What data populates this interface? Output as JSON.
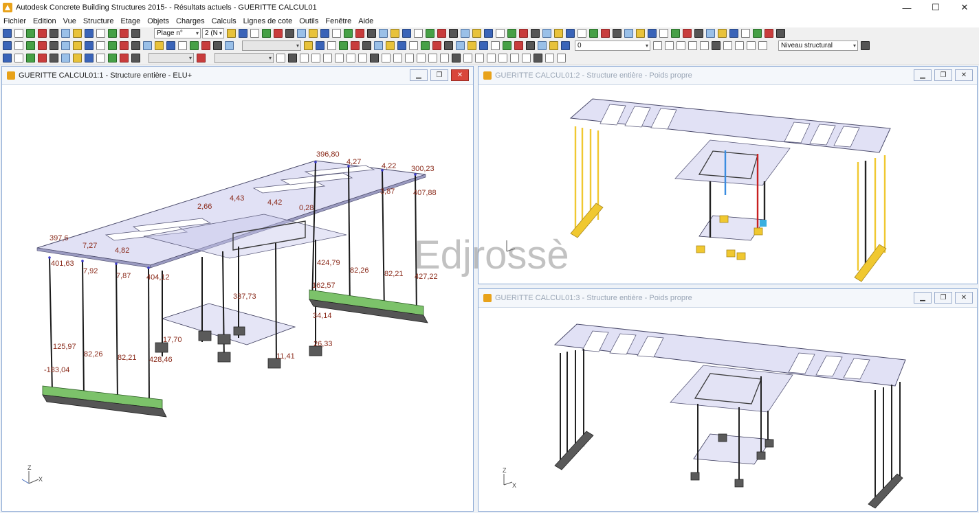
{
  "app": {
    "title": "Autodesk Concrete Building Structures 2015- - Résultats actuels - GUERITTE CALCUL01",
    "min_glyph": "—",
    "max_glyph": "☐",
    "close_glyph": "✕"
  },
  "menu": {
    "items": [
      "Fichier",
      "Edition",
      "Vue",
      "Structure",
      "Etage",
      "Objets",
      "Charges",
      "Calculs",
      "Lignes de cote",
      "Outils",
      "Fenêtre",
      "Aide"
    ]
  },
  "toolbars": {
    "level_combo": "Plage n°",
    "level_combo2": "2 (N",
    "layer_combo": "0",
    "niveau_combo": "Niveau structural"
  },
  "windows": [
    {
      "title": "GUERITTE CALCUL01:1 - Structure entière - ELU+",
      "active": true
    },
    {
      "title": "GUERITTE CALCUL01:2 - Structure entière - Poids propre",
      "active": false
    },
    {
      "title": "GUERITTE CALCUL01:3 - Structure entière - Poids propre",
      "active": false
    }
  ],
  "axis_labels": {
    "z": "Z",
    "x": "X"
  },
  "result_labels": [
    "396,80",
    "4,27",
    "4,22",
    "300,23",
    "407,88",
    "3,87",
    "4,43",
    "4,42",
    "2,66",
    "0,28",
    "397,6",
    "7,27",
    "4,82",
    "401,63",
    "7,92",
    "7,87",
    "404,12",
    "424,79",
    "82,26",
    "82,21",
    "427,22",
    "162,57",
    "337,73",
    "34,14",
    "125,97",
    "82,26",
    "82,21",
    "428,46",
    "-183,04",
    "17,70",
    "26,33",
    "11,41"
  ],
  "watermark": "Edjrossè",
  "colors": {
    "slab": "#c8c8ec",
    "column": "#222222",
    "footing_green": "#7cc26a",
    "label": "#8a2a1a",
    "highlight_yellow": "#f0c830"
  }
}
